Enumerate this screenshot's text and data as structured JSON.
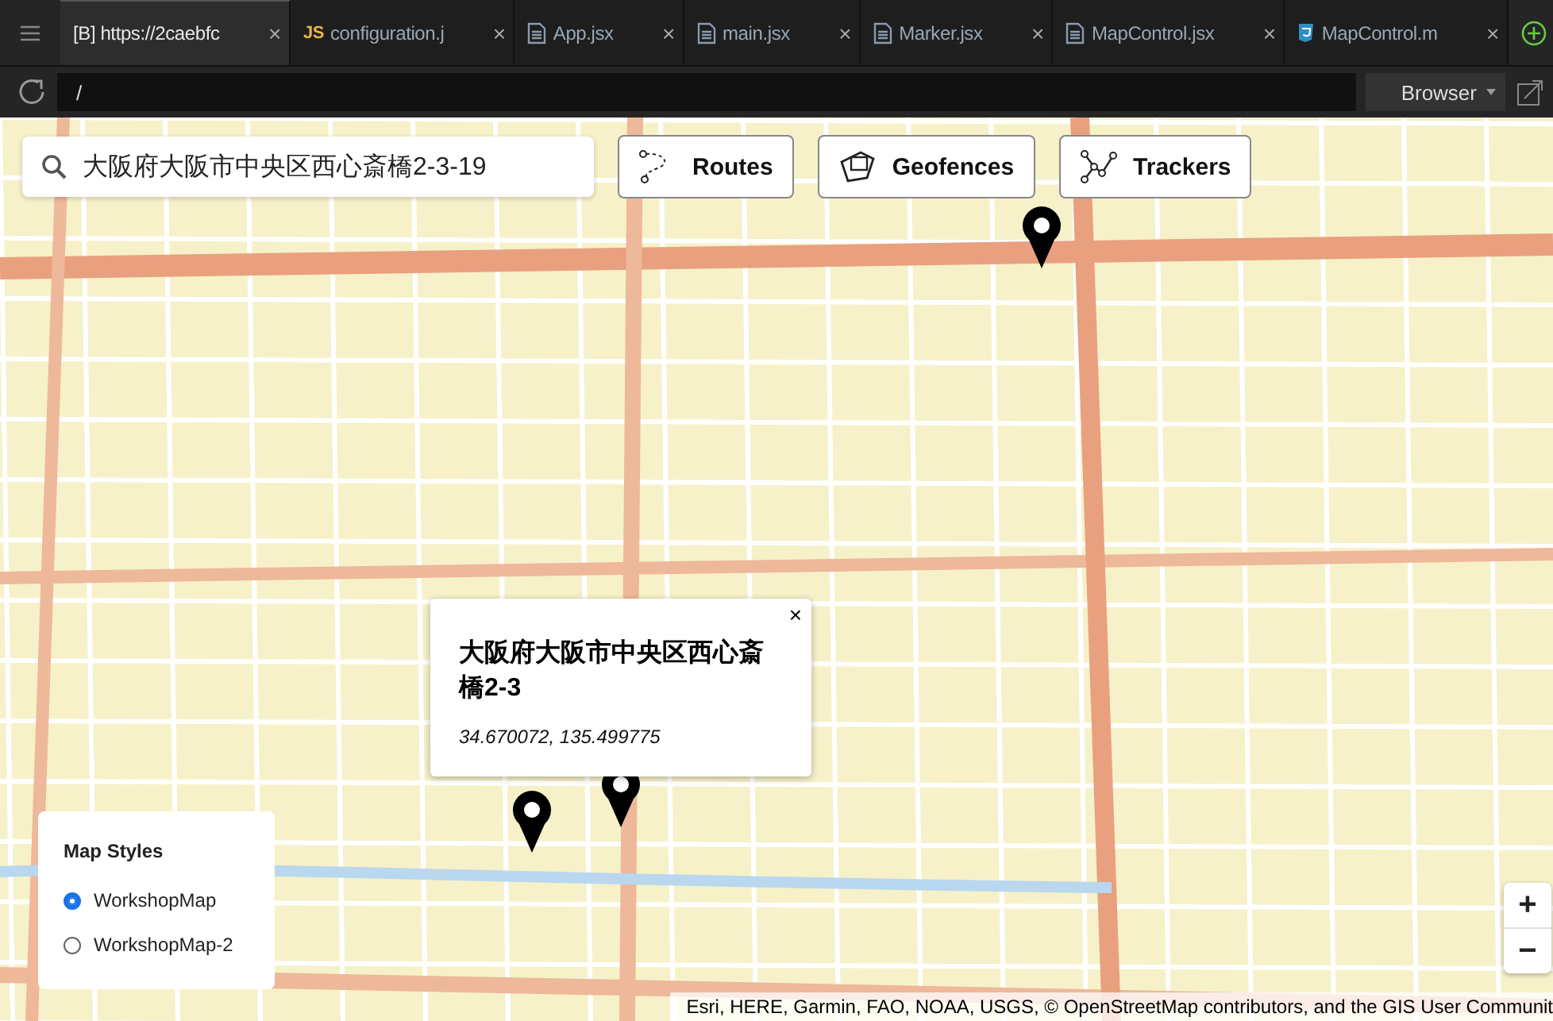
{
  "tabs": [
    {
      "label": "[B] https://2caebfc",
      "kind": "browser",
      "close": "×",
      "selected": true
    },
    {
      "label": "configuration.j",
      "kind": "js",
      "badge": "JS",
      "close": "×",
      "selected": false
    },
    {
      "label": "App.jsx",
      "kind": "file",
      "close": "×",
      "selected": false
    },
    {
      "label": "main.jsx",
      "kind": "file",
      "close": "×",
      "selected": false
    },
    {
      "label": "Marker.jsx",
      "kind": "file",
      "close": "×",
      "selected": false
    },
    {
      "label": "MapControl.jsx",
      "kind": "file",
      "close": "×",
      "selected": false
    },
    {
      "label": "MapControl.m",
      "kind": "css",
      "close": "×",
      "selected": false
    }
  ],
  "address_bar": {
    "value": "/",
    "mode": "Browser"
  },
  "map": {
    "search": {
      "value": "大阪府大阪市中央区西心斎橋2-3-19"
    },
    "buttons": [
      {
        "label": "Routes",
        "kind": "routes"
      },
      {
        "label": "Geofences",
        "kind": "geofences"
      },
      {
        "label": "Trackers",
        "kind": "trackers"
      }
    ],
    "popup": {
      "title": "大阪府大阪市中央区西心斎橋2-3",
      "coordinates": "34.670072, 135.499775",
      "close": "×"
    },
    "map_styles": {
      "title": "Map Styles",
      "options": [
        {
          "label": "WorkshopMap",
          "selected": true
        },
        {
          "label": "WorkshopMap-2",
          "selected": false
        }
      ]
    },
    "zoom": {
      "in": "+",
      "out": "−"
    },
    "attribution": "Esri, HERE, Garmin, FAO, NOAA, USGS, © OpenStreetMap contributors, and the GIS User Communit"
  }
}
